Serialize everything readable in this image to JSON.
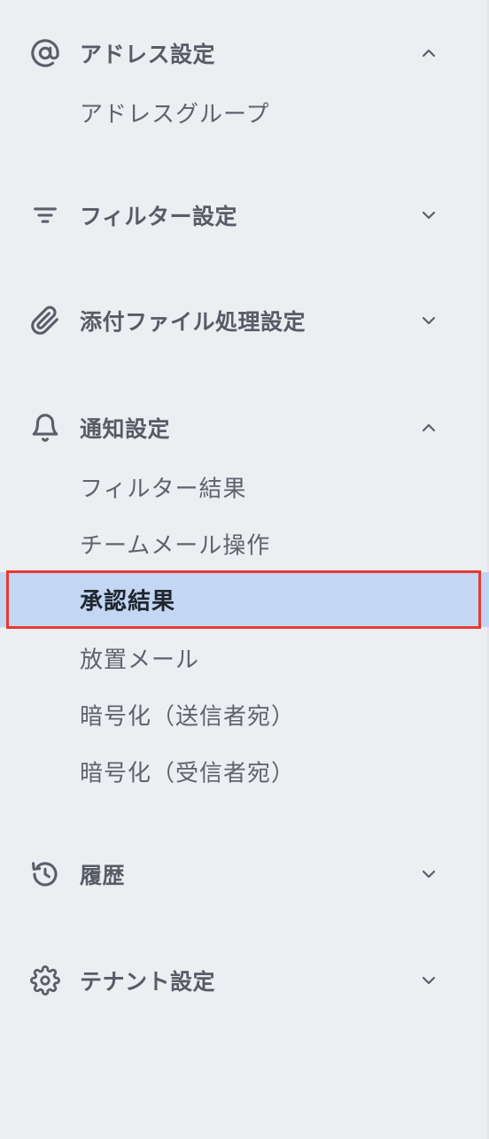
{
  "sections": [
    {
      "id": "address",
      "label": "アドレス設定",
      "icon": "at-sign-icon",
      "expanded": true,
      "items": [
        {
          "label": "アドレスグループ"
        }
      ]
    },
    {
      "id": "filter",
      "label": "フィルター設定",
      "icon": "filter-icon",
      "expanded": false,
      "items": []
    },
    {
      "id": "attachment",
      "label": "添付ファイル処理設定",
      "icon": "paperclip-icon",
      "expanded": false,
      "items": []
    },
    {
      "id": "notification",
      "label": "通知設定",
      "icon": "bell-icon",
      "expanded": true,
      "items": [
        {
          "label": "フィルター結果"
        },
        {
          "label": "チームメール操作"
        },
        {
          "label": "承認結果",
          "active": true
        },
        {
          "label": "放置メール"
        },
        {
          "label": "暗号化（送信者宛）"
        },
        {
          "label": "暗号化（受信者宛）"
        }
      ]
    },
    {
      "id": "history",
      "label": "履歴",
      "icon": "history-icon",
      "expanded": false,
      "items": []
    },
    {
      "id": "tenant",
      "label": "テナント設定",
      "icon": "gear-icon",
      "expanded": false,
      "items": []
    }
  ],
  "colors": {
    "background": "#eceef2",
    "active_background": "#c3d6f3",
    "highlight_border": "#e8392f",
    "text": "#5a5f6a"
  }
}
